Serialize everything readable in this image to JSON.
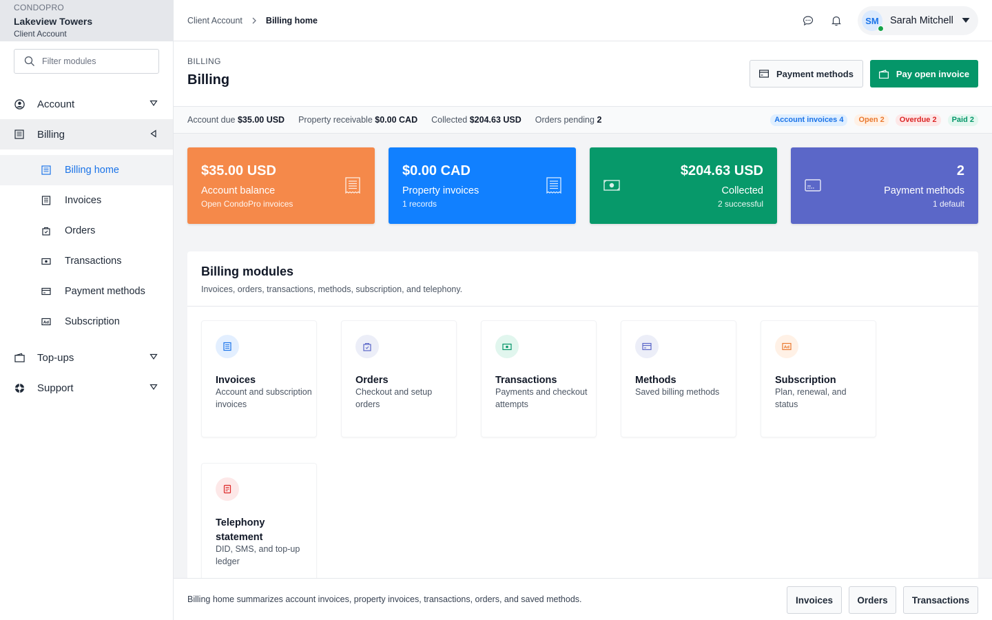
{
  "sidebar": {
    "brand": "CONDOPRO",
    "org": "Lakeview Towers",
    "org_sub": "Client Account",
    "filter_placeholder": "Filter modules",
    "nav": [
      {
        "label": "Account",
        "icon": "user-circle-icon"
      },
      {
        "label": "Billing",
        "icon": "ledger-icon"
      },
      {
        "label": "Top-ups",
        "icon": "wallet-icon"
      },
      {
        "label": "Support",
        "icon": "lifebuoy-icon"
      }
    ],
    "billing_sub": [
      {
        "label": "Billing home",
        "icon": "document-icon"
      },
      {
        "label": "Invoices",
        "icon": "invoice-icon"
      },
      {
        "label": "Orders",
        "icon": "shopping-bag-icon"
      },
      {
        "label": "Transactions",
        "icon": "cash-icon"
      },
      {
        "label": "Payment methods",
        "icon": "credit-card-icon"
      },
      {
        "label": "Subscription",
        "icon": "ad-icon"
      }
    ]
  },
  "topbar": {
    "crumb_parent": "Client Account",
    "crumb_current": "Billing home",
    "user_initials": "SM",
    "user_name": "Sarah Mitchell"
  },
  "page": {
    "eyebrow": "BILLING",
    "title": "Billing",
    "btn_payment_methods": "Payment methods",
    "btn_pay_invoice": "Pay open invoice"
  },
  "stats": {
    "account_due_label": "Account due",
    "account_due": "$35.00 USD",
    "property_label": "Property receivable",
    "property": "$0.00 CAD",
    "collected_label": "Collected",
    "collected": "$204.63 USD",
    "orders_label": "Orders pending",
    "orders": "2",
    "badges": [
      {
        "label": "Account invoices 4",
        "color": "#1a73e8",
        "bg": "#e0efff"
      },
      {
        "label": "Open 2",
        "color": "#ea7a30",
        "bg": "#fff1e6"
      },
      {
        "label": "Overdue 2",
        "color": "#dc2626",
        "bg": "#fde8e8"
      },
      {
        "label": "Paid 2",
        "color": "#059669",
        "bg": "#e3f7ef"
      }
    ]
  },
  "kpis": [
    {
      "value": "$35.00 USD",
      "label": "Account balance",
      "sub": "Open CondoPro invoices",
      "color": "#f5894a",
      "icon": "receipt-icon"
    },
    {
      "value": "$0.00 CAD",
      "label": "Property invoices",
      "sub": "1 records",
      "color": "#1180ff",
      "icon": "receipt-icon"
    },
    {
      "value": "$204.63 USD",
      "label": "Collected",
      "sub": "2 successful",
      "color": "#07996a",
      "icon": "cash-icon"
    },
    {
      "value": "2",
      "label": "Payment methods",
      "sub": "1 default",
      "color": "#5b67c8",
      "icon": "credit-card-icon"
    }
  ],
  "modules": {
    "title": "Billing modules",
    "subtitle": "Invoices, orders, transactions, methods, subscription, and telephony.",
    "items": [
      {
        "title": "Invoices",
        "desc": "Account and subscription invoices",
        "icon": "invoice-icon"
      },
      {
        "title": "Orders",
        "desc": "Checkout and setup orders",
        "icon": "shopping-bag-icon"
      },
      {
        "title": "Transactions",
        "desc": "Payments and checkout attempts",
        "icon": "cash-icon"
      },
      {
        "title": "Methods",
        "desc": "Saved billing methods",
        "icon": "credit-card-icon"
      },
      {
        "title": "Subscription",
        "desc": "Plan, renewal, and status",
        "icon": "ad-icon"
      },
      {
        "title": "Telephony statement",
        "desc": "DID, SMS, and top-up ledger",
        "icon": "statement-icon"
      }
    ]
  },
  "footer": {
    "text": "Billing home summarizes account invoices, property invoices, transactions, orders, and saved methods.",
    "btn_invoices": "Invoices",
    "btn_orders": "Orders",
    "btn_transactions": "Transactions"
  }
}
